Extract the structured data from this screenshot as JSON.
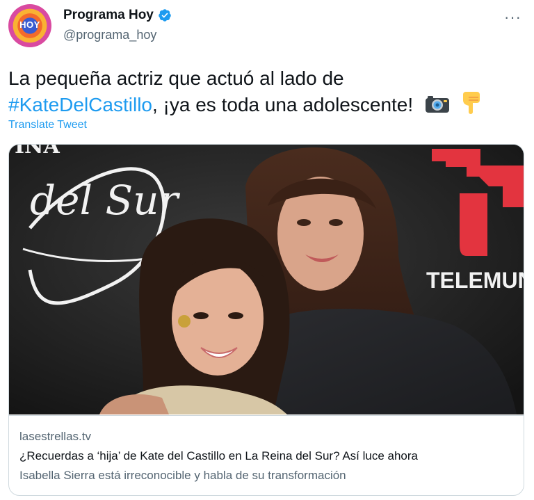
{
  "author": {
    "display_name": "Programa Hoy",
    "handle": "@programa_hoy",
    "avatar_icon": "programa-hoy-logo",
    "verified": true
  },
  "more_menu": {
    "icon": "more-horizontal-icon",
    "label": "···"
  },
  "tweet": {
    "text_before": "La pequeña actriz que actuó al lado de",
    "hashtag": "#KateDelCastillo",
    "text_after": ", ¡ya es toda una adolescente!",
    "emojis": [
      "camera-with-flash-icon",
      "backhand-index-pointing-down-icon"
    ]
  },
  "translate_label": "Translate Tweet",
  "link_card": {
    "image_icon": "photo-kate-del-castillo-isabella-sierra",
    "image_backdrop_text_1": "del Sur",
    "image_backdrop_text_2": "TELEMUNDO",
    "domain": "lasestrellas.tv",
    "title": "¿Recuerdas a ‘hija’ de Kate del Castillo en La Reina del Sur? Así luce ahora",
    "description": "Isabella Sierra está irreconocible y habla de su transformación"
  },
  "colors": {
    "link_blue": "#1d9bf0",
    "text_primary": "#0f1419",
    "text_secondary": "#536471",
    "border": "#cfd9de",
    "telemundo_red": "#e3343f"
  }
}
